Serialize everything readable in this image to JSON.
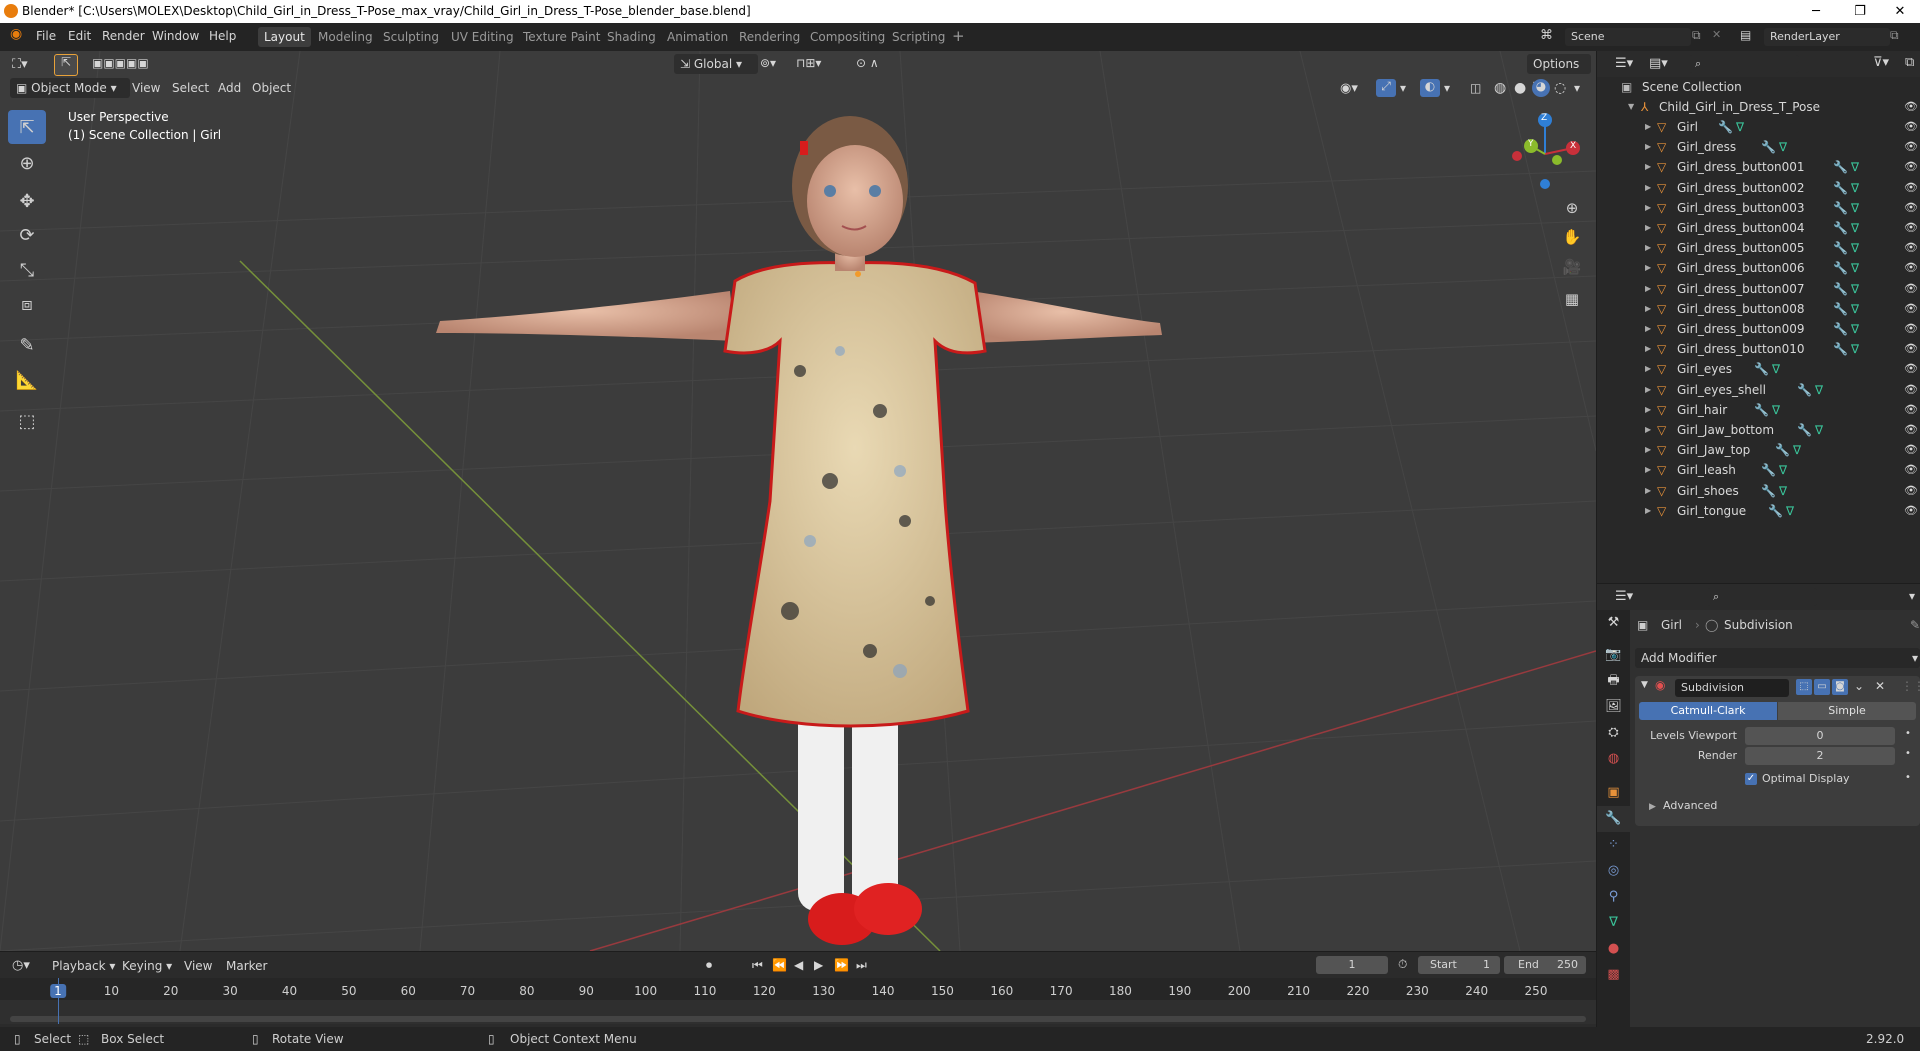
{
  "title_bar": {
    "title": "Blender* [C:\\Users\\MOLEX\\Desktop\\Child_Girl_in_Dress_T-Pose_max_vray/Child_Girl_in_Dress_T-Pose_blender_base.blend]",
    "minimize": "─",
    "restore": "❐",
    "close": "✕"
  },
  "menu": [
    "File",
    "Edit",
    "Render",
    "Window",
    "Help"
  ],
  "workspace_tabs": [
    "Layout",
    "Modeling",
    "Sculpting",
    "UV Editing",
    "Texture Paint",
    "Shading",
    "Animation",
    "Rendering",
    "Compositing",
    "Scripting"
  ],
  "active_workspace": "Layout",
  "scene": {
    "scene_name": "Scene",
    "view_layer": "RenderLayer"
  },
  "viewport_header": {
    "mode": "Object Mode",
    "menus": [
      "View",
      "Select",
      "Add",
      "Object"
    ],
    "transform_orientation": "Global",
    "options_label": "Options"
  },
  "viewport_overlay": {
    "perspective": "User Perspective",
    "collection": "(1) Scene Collection | Girl"
  },
  "gizmo": {
    "z": "Z",
    "y": "Y",
    "x": "X"
  },
  "outliner": {
    "root": "Scene Collection",
    "collection": "Child_Girl_in_Dress_T_Pose",
    "items": [
      "Girl",
      "Girl_dress",
      "Girl_dress_button001",
      "Girl_dress_button002",
      "Girl_dress_button003",
      "Girl_dress_button004",
      "Girl_dress_button005",
      "Girl_dress_button006",
      "Girl_dress_button007",
      "Girl_dress_button008",
      "Girl_dress_button009",
      "Girl_dress_button010",
      "Girl_eyes",
      "Girl_eyes_shell",
      "Girl_hair",
      "Girl_Jaw_bottom",
      "Girl_Jaw_top",
      "Girl_leash",
      "Girl_shoes",
      "Girl_tongue"
    ]
  },
  "properties": {
    "object_name": "Girl",
    "modifier_context": "Subdivision",
    "add_modifier": "Add Modifier",
    "modifier_name": "Subdivision",
    "algorithm_options": [
      "Catmull-Clark",
      "Simple"
    ],
    "active_algorithm": "Catmull-Clark",
    "levels_viewport_label": "Levels Viewport",
    "levels_viewport_value": "0",
    "render_label": "Render",
    "render_value": "2",
    "optimal_display_label": "Optimal Display",
    "optimal_display_checked": true,
    "advanced_label": "Advanced"
  },
  "timeline": {
    "menus": [
      "Playback",
      "Keying",
      "View",
      "Marker"
    ],
    "current_frame": "1",
    "start_label": "Start",
    "start_value": "1",
    "end_label": "End",
    "end_value": "250",
    "ticks": [
      "1",
      "10",
      "20",
      "30",
      "40",
      "50",
      "60",
      "70",
      "80",
      "90",
      "100",
      "110",
      "120",
      "130",
      "140",
      "150",
      "160",
      "170",
      "180",
      "190",
      "200",
      "210",
      "220",
      "230",
      "240",
      "250"
    ]
  },
  "status_bar": {
    "select": "Select",
    "box_select": "Box Select",
    "rotate_view": "Rotate View",
    "context_menu": "Object Context Menu",
    "version": "2.92.0"
  },
  "colors": {
    "accent": "#4772b3",
    "mesh_icon": "#e8923a",
    "modifier_icon": "#7b9ed8",
    "data_icon": "#3ac49a",
    "x_axis": "#c8303a",
    "y_axis": "#8bbb2b",
    "z_axis": "#2f7fd6"
  }
}
